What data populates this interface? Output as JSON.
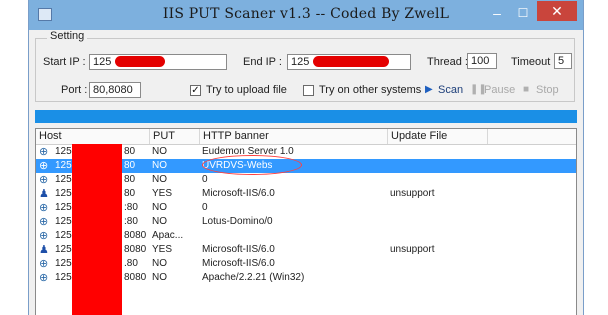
{
  "window": {
    "title": "IIS PUT Scaner v1.3 -- Coded By ZwelL",
    "minimize_label": "–",
    "maximize_label": "☐",
    "close_label": "✕",
    "icon": "app-icon"
  },
  "setting": {
    "group_label": "Setting",
    "start_ip_label": "Start IP :",
    "start_ip_value": "125",
    "end_ip_label": "End IP :",
    "end_ip_value": "125",
    "thread_label": "Thread :",
    "thread_value": "100",
    "timeout_label": "Timeout :",
    "timeout_value": "5",
    "port_label": "Port :",
    "port_value": "80,8080",
    "try_upload_label": "Try to upload file",
    "try_upload_checked": true,
    "try_other_label": "Try on other systems",
    "try_other_checked": false,
    "scan_label": "Scan",
    "pause_label": "Pause",
    "stop_label": "Stop"
  },
  "progress_fraction": 1.0,
  "colors": {
    "progress": "#1a8fe6",
    "selection": "#3399ff",
    "redaction": "#ff0000"
  },
  "table": {
    "columns": [
      "Host",
      "PUT",
      "HTTP banner",
      "Update File"
    ],
    "rows": [
      {
        "host_prefix": "125",
        "host_suffix": "80",
        "put": "NO",
        "banner": "Eudemon Server 1.0",
        "update": "",
        "icon": "network-icon",
        "selected": false
      },
      {
        "host_prefix": "125",
        "host_suffix": "80",
        "put": "NO",
        "banner": "UVRDVS-Webs",
        "update": "",
        "icon": "network-icon",
        "selected": true
      },
      {
        "host_prefix": "125",
        "host_suffix": "80",
        "put": "NO",
        "banner": "0",
        "update": "",
        "icon": "network-icon",
        "selected": false
      },
      {
        "host_prefix": "125",
        "host_suffix": "80",
        "put": "YES",
        "banner": "Microsoft-IIS/6.0",
        "update": "unsupport",
        "icon": "user-icon",
        "selected": false
      },
      {
        "host_prefix": "125",
        "host_suffix": ":80",
        "put": "NO",
        "banner": "0",
        "update": "",
        "icon": "network-icon",
        "selected": false
      },
      {
        "host_prefix": "125",
        "host_suffix": ":80",
        "put": "NO",
        "banner": "Lotus-Domino/0",
        "update": "",
        "icon": "network-icon",
        "selected": false
      },
      {
        "host_prefix": "125",
        "host_suffix": "8080",
        "put": "Apac...",
        "banner": "",
        "update": "",
        "icon": "network-icon",
        "selected": false
      },
      {
        "host_prefix": "125",
        "host_suffix": "8080",
        "put": "YES",
        "banner": "Microsoft-IIS/6.0",
        "update": "unsupport",
        "icon": "user-icon",
        "selected": false
      },
      {
        "host_prefix": "125",
        "host_suffix": ".80",
        "put": "NO",
        "banner": "Microsoft-IIS/6.0",
        "update": "",
        "icon": "network-icon",
        "selected": false
      },
      {
        "host_prefix": "125",
        "host_suffix": "8080",
        "put": "NO",
        "banner": "Apache/2.2.21 (Win32)",
        "update": "",
        "icon": "network-icon",
        "selected": false
      }
    ]
  }
}
